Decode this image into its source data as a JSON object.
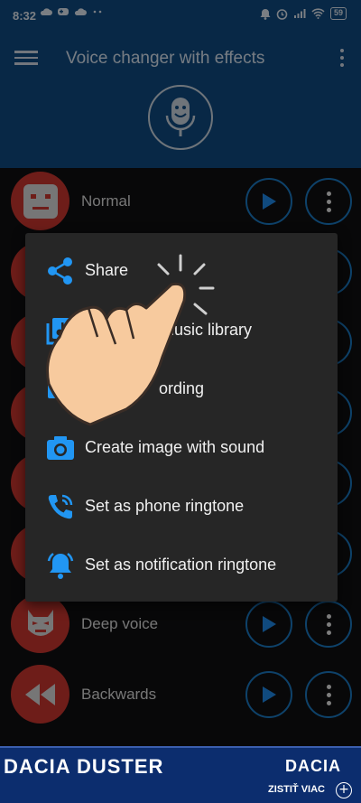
{
  "status_bar": {
    "time": "8:32",
    "battery": "59"
  },
  "app_bar": {
    "title": "Voice changer with effects"
  },
  "list": {
    "items": [
      {
        "label": "Normal",
        "icon": "robot-face-icon"
      },
      {
        "label": "",
        "icon": ""
      },
      {
        "label": "",
        "icon": ""
      },
      {
        "label": "",
        "icon": ""
      },
      {
        "label": "",
        "icon": ""
      },
      {
        "label": "",
        "icon": ""
      },
      {
        "label": "Deep voice",
        "icon": "masked-face-icon"
      },
      {
        "label": "Backwards",
        "icon": "rewind-icon"
      }
    ]
  },
  "popup_menu": {
    "items": [
      {
        "label": "Share",
        "icon": "share-icon"
      },
      {
        "label": "music library",
        "icon": "music-library-icon"
      },
      {
        "label": "ording",
        "icon": "recording-icon"
      },
      {
        "label": "Create image with sound",
        "icon": "camera-icon"
      },
      {
        "label": "Set as phone ringtone",
        "icon": "phone-ringtone-icon"
      },
      {
        "label": "Set as notification ringtone",
        "icon": "bell-icon"
      }
    ]
  },
  "ad": {
    "brand": "DACIA DUSTER",
    "logo": "DACIA",
    "cta": "ZISTIŤ VIAC"
  },
  "colors": {
    "accent": "#2196f3",
    "avatar": "#c9352f",
    "appbar": "#0f4a80"
  }
}
